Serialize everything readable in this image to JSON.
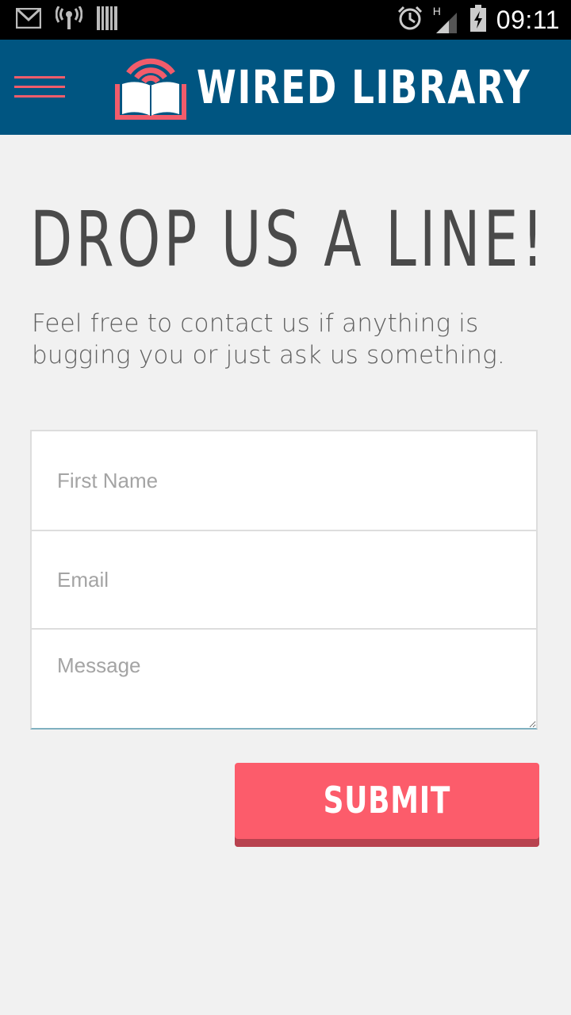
{
  "status_bar": {
    "time": "09:11",
    "network_type": "H",
    "left_icons": [
      "gmail-icon",
      "wireless-broadcast-icon",
      "barcode-icon"
    ],
    "right_icons": [
      "alarm-icon",
      "signal-icon",
      "battery-charging-icon"
    ]
  },
  "header": {
    "brand": "WIRED LIBRARY",
    "menu_icon": "hamburger-menu-icon",
    "logo_icon": "wifi-book-logo",
    "accent_color": "#f15c6b",
    "background_color": "#005581"
  },
  "main": {
    "title": "DROP US A LINE!",
    "intro": "Feel free to contact us if anything is bugging you or just ask us something."
  },
  "form": {
    "first_name_placeholder": "First Name",
    "email_placeholder": "Email",
    "message_placeholder": "Message",
    "submit_label": "SUBMIT",
    "submit_color": "#fc5c6b"
  }
}
